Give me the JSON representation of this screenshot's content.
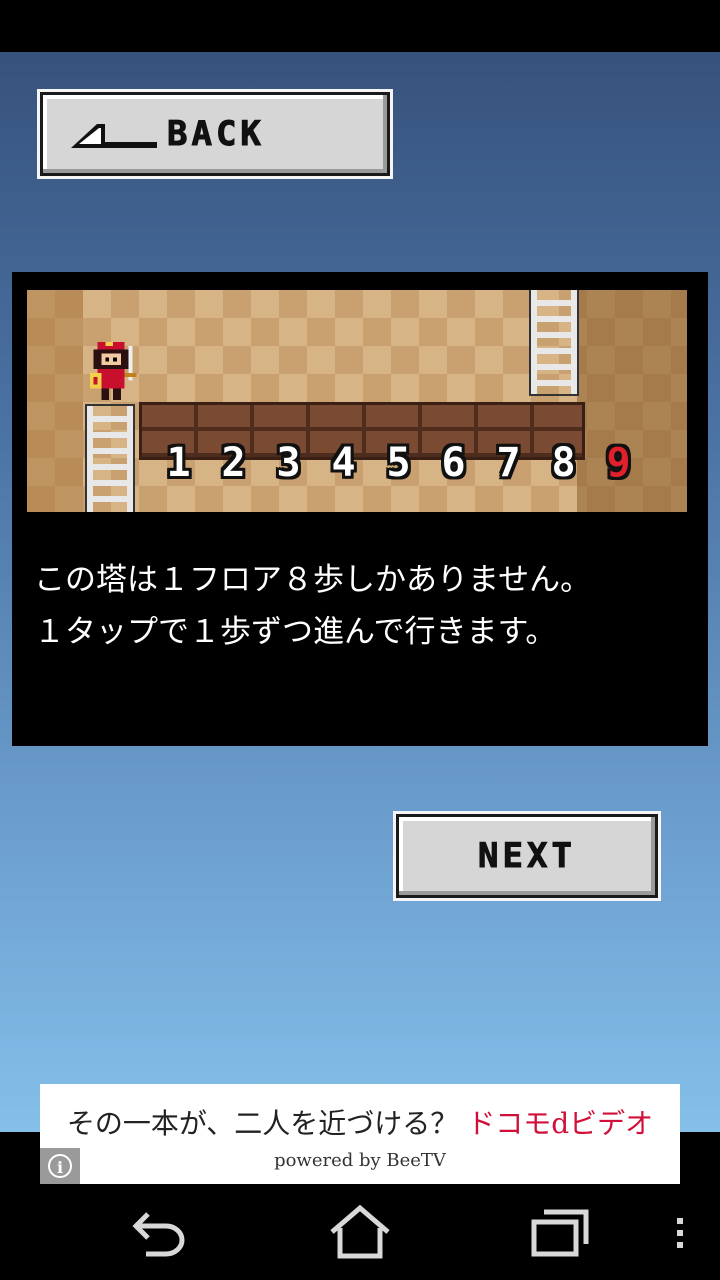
{
  "back_button": {
    "label": "BACK"
  },
  "next_button": {
    "label": "NEXT"
  },
  "scene": {
    "steps": [
      "1",
      "2",
      "3",
      "4",
      "5",
      "6",
      "7",
      "8"
    ],
    "goal_step": "9"
  },
  "description": {
    "line1": "この塔は１フロア８歩しかありません。",
    "line2": "１タップで１歩ずつ進んで行きます。"
  },
  "ad": {
    "tagline": "その一本が、二人を近づける？",
    "brand": "ドコモdビデオ",
    "powered_by": "powered by BeeTV",
    "info_icon": "i"
  },
  "navbar": {
    "icons": [
      "back-icon",
      "home-icon",
      "recent-apps-icon",
      "menu-icon"
    ]
  },
  "colors": {
    "goal_number": "#e0202a",
    "ad_brand": "#d0103a",
    "sky_top": "#37527c",
    "sky_bottom": "#84c0ea"
  }
}
